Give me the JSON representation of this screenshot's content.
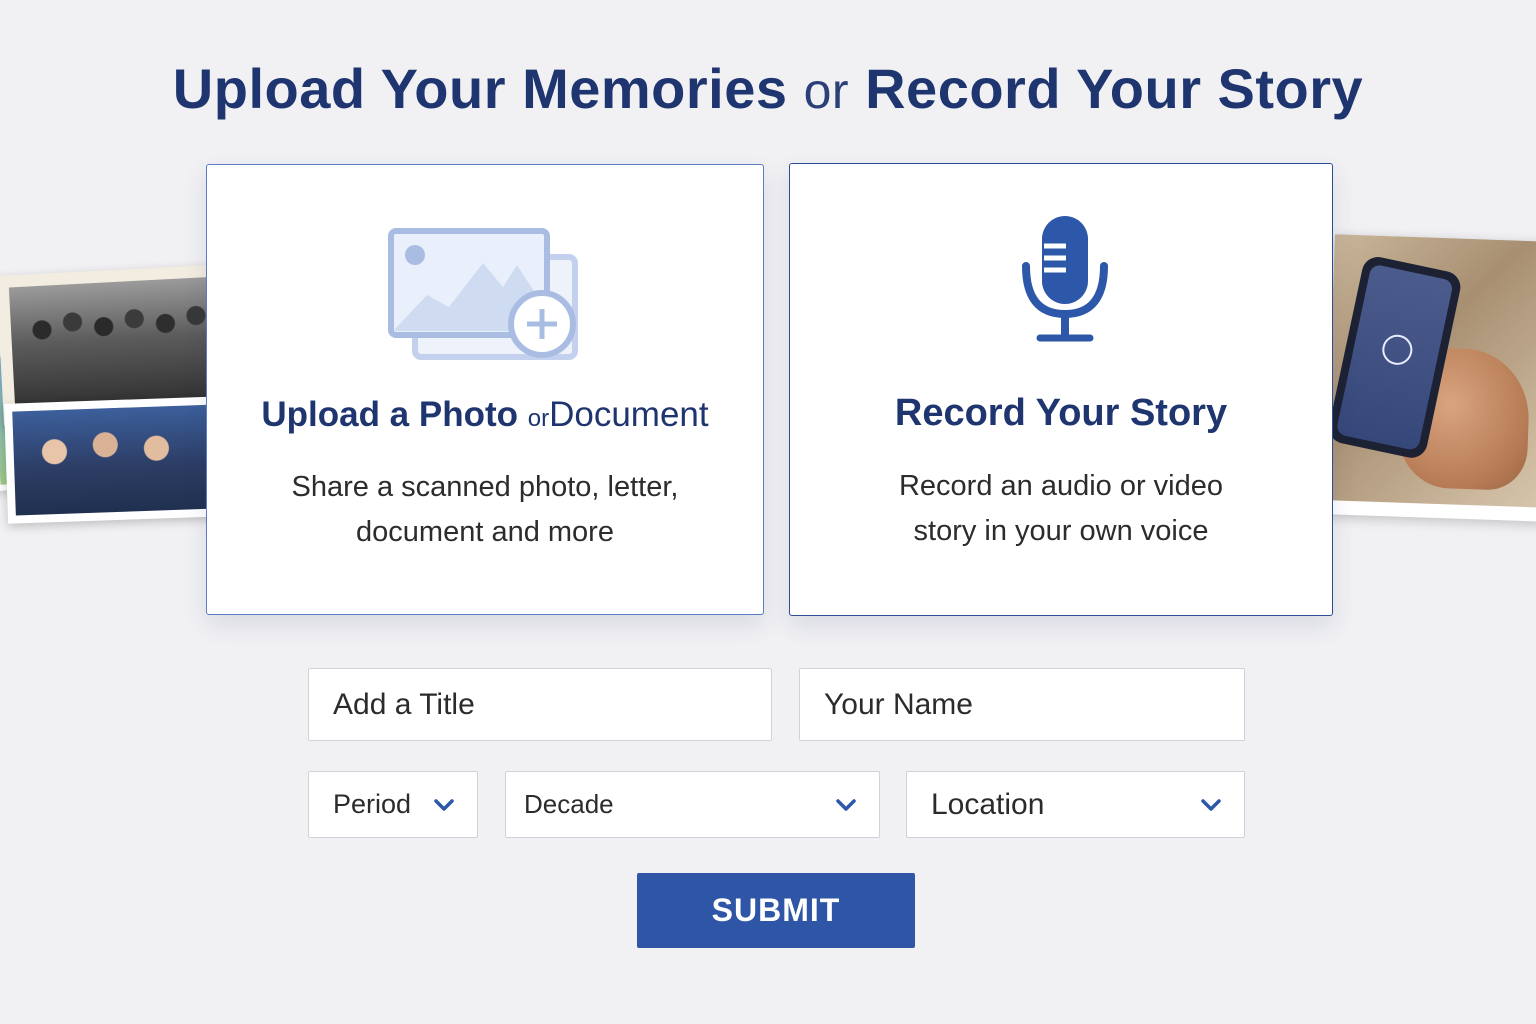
{
  "header": {
    "title_part1": "Upload Your Memories",
    "title_or": "or",
    "title_part2": "Record Your Story"
  },
  "upload_card": {
    "icon": "image-upload-icon",
    "title_part1": "Upload a Photo",
    "title_or": "or",
    "title_part2": "Document",
    "description_line1": "Share a scanned photo, letter,",
    "description_line2": "document and more"
  },
  "record_card": {
    "icon": "microphone-icon",
    "title": "Record Your Story",
    "description_line1": "Record an audio or video",
    "description_line2": "story in your own voice"
  },
  "form": {
    "title_placeholder": "Add a Title",
    "name_placeholder": "Your Name",
    "period_label": "Period",
    "decade_label": "Decade",
    "location_label": "Location",
    "submit_label": "SUBMIT"
  },
  "colors": {
    "brand_navy": "#1f3570",
    "accent_blue": "#2f56a6",
    "icon_light_blue": "#a9bde3",
    "background": "#f1f1f4"
  }
}
